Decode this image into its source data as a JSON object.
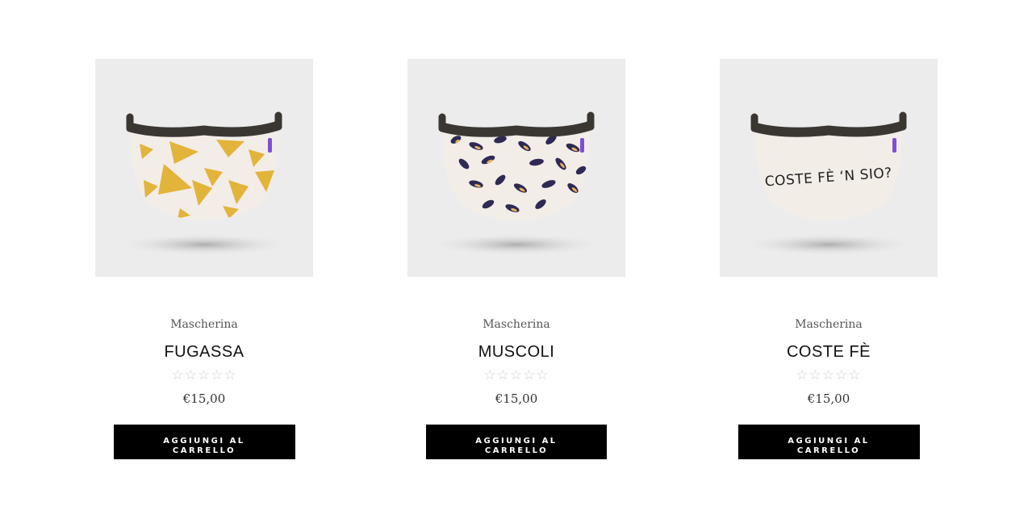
{
  "products": [
    {
      "category": "Mascherina",
      "title": "FUGASSA",
      "rating_stars": "☆☆☆☆☆",
      "rating": 0,
      "price": "€15,00",
      "button_label": "AGGIUNGI AL CARRELLO",
      "image": "mask-focaccia-pattern"
    },
    {
      "category": "Mascherina",
      "title": "MUSCOLI",
      "rating_stars": "☆☆☆☆☆",
      "rating": 0,
      "price": "€15,00",
      "button_label": "AGGIUNGI AL CARRELLO",
      "image": "mask-mussels-pattern"
    },
    {
      "category": "Mascherina",
      "title": "COSTE FÈ",
      "rating_stars": "☆☆☆☆☆",
      "rating": 0,
      "price": "€15,00",
      "button_label": "AGGIUNGI AL CARRELLO",
      "image": "mask-text-print",
      "print_text": "COSTE FÈ ‘N SIO?"
    }
  ],
  "colors": {
    "button_bg": "#000000",
    "button_text": "#ffffff",
    "image_bg": "#ececec",
    "mask_body": "#f3ede8",
    "strap": "#3a3733",
    "tag": "#7d4fd6",
    "focaccia": "#e2b43a",
    "mussel_dark": "#2e2a55",
    "mussel_light": "#e9b25c"
  }
}
